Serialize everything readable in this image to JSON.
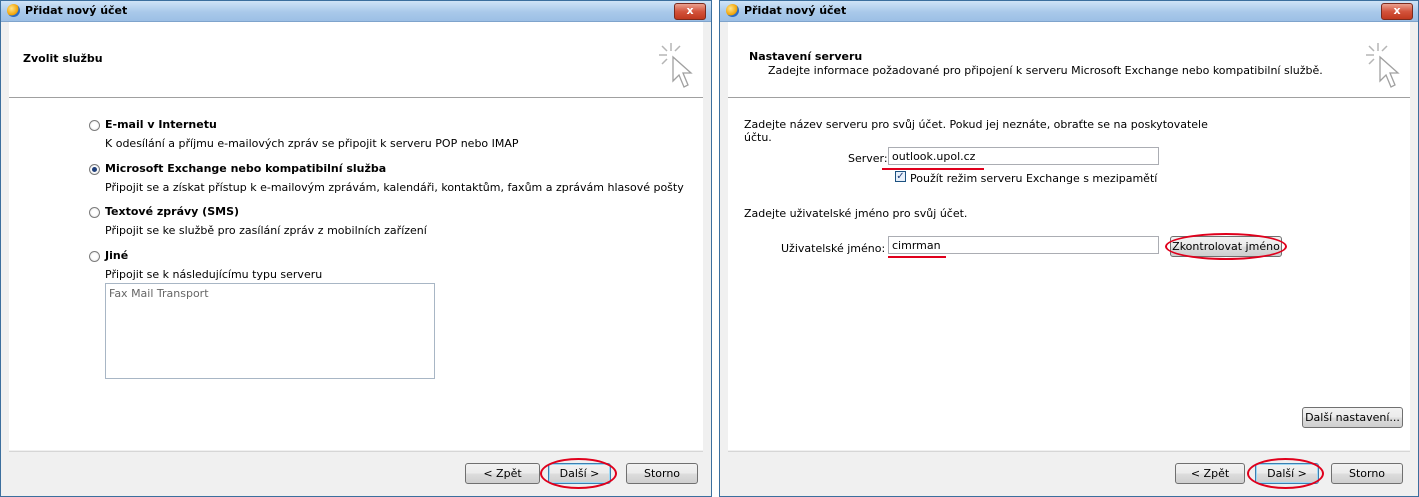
{
  "window1": {
    "title": "Přidat nový účet",
    "close_label": "x",
    "header_title": "Zvolit službu",
    "options": [
      {
        "label": "E-mail v Internetu",
        "desc": "K odesílání a příjmu e-mailových zpráv se připojit k serveru POP nebo IMAP",
        "checked": false
      },
      {
        "label": "Microsoft Exchange nebo kompatibilní služba",
        "desc": "Připojit se a získat přístup k e-mailovým zprávám, kalendáři, kontaktům, faxům a zprávám hlasové pošty",
        "checked": true
      },
      {
        "label": "Textové zprávy (SMS)",
        "desc": "Připojit se ke službě pro zasílání zpráv z mobilních zařízení",
        "checked": false
      },
      {
        "label": "Jiné",
        "desc": "Připojit se k následujícímu typu serveru",
        "checked": false
      }
    ],
    "server_types": [
      "Fax Mail Transport"
    ],
    "back_label": "< Zpět",
    "next_label": "Další >",
    "cancel_label": "Storno"
  },
  "window2": {
    "title": "Přidat nový účet",
    "close_label": "x",
    "header_title": "Nastavení serveru",
    "header_sub": "Zadejte informace požadované pro připojení k serveru Microsoft Exchange nebo kompatibilní službě.",
    "server_instruction_line1": "Zadejte název serveru pro svůj účet. Pokud jej neznáte, obraťte se na poskytovatele",
    "server_instruction_line2": "účtu.",
    "server_label": "Server:",
    "server_value": "outlook.upol.cz",
    "cached_mode_label": "Použít režim serveru Exchange s mezipamětí",
    "cached_mode_checked": true,
    "username_instruction": "Zadejte uživatelské jméno pro svůj účet.",
    "username_label": "Uživatelské jméno:",
    "username_value": "cimrman",
    "check_name_label": "Zkontrolovat jméno",
    "more_settings_label": "Další nastavení...",
    "back_label": "< Zpět",
    "next_label": "Další >",
    "cancel_label": "Storno"
  },
  "colors": {
    "annotation_red": "#e0001c",
    "titlebar_blue": "#a9c9ea"
  }
}
